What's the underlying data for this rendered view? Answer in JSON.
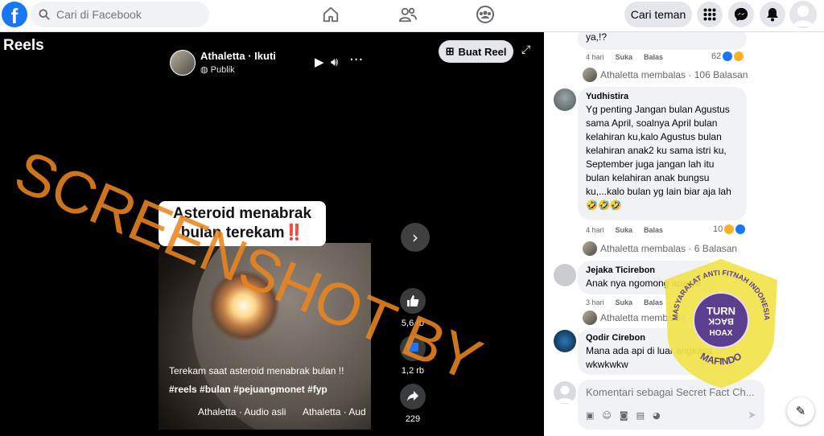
{
  "topbar": {
    "logo_letter": "f",
    "search_placeholder": "Cari di Facebook",
    "find_friends": "Cari teman"
  },
  "reels": {
    "title": "Reels",
    "author_name": "Athaletta · Ikuti",
    "privacy": "Publik",
    "create_reel": "Buat Reel",
    "caption_line1": "Asteroid menabrak",
    "caption_line2": "bulan terekam",
    "caption_mark": "‼️",
    "description": "Terekam saat asteroid menabrak bulan !!",
    "hashtags": "#reels #bulan #pejuangmonet #fyp",
    "audio_a": "Athaletta · Audio asli",
    "audio_b": "Athaletta · Aud",
    "likes": "5,6 rb",
    "comments": "1,2 rb",
    "shares": "229"
  },
  "comments": {
    "c1": {
      "text": "ya,!?",
      "time": "4 hari",
      "like": "Suka",
      "reply": "Balas",
      "reacts": "62"
    },
    "r1": "Athaletta membalas · 106 Balasan",
    "c2": {
      "author": "Yudhistira",
      "text": "Yg penting Jangan bulan Agustus sama April, soalnya April bulan kelahiran ku,kalo Agustus bulan kelahiran anak2 ku sama istri ku, September juga jangan lah itu bulan kelahiran anak bungsu ku,...kalo bulan yg lain biar aja lah🤣🤣🤣",
      "time": "4 hari",
      "like": "Suka",
      "reply": "Balas",
      "reacts": "10"
    },
    "r2": "Athaletta membalas · 6 Balasan",
    "c3": {
      "author": "Jejaka Ticirebon",
      "text": "Anak nya ngomong apa ya",
      "time": "3 hari",
      "like": "Suka",
      "reply": "Balas"
    },
    "r3": "Athaletta membalas · 2 Balasan",
    "c4": {
      "author": "Qodir Cirebon",
      "text": "Mana ada api di luar angkasa wkwkwkw"
    },
    "composer_placeholder": "Komentari sebagai Secret Fact Ch..."
  },
  "watermark": {
    "text": "SCREENSHOT BY",
    "seal_top": "MASYARAKAT ANTI FITNAH INDONESIA",
    "seal_center": "TURN BACK HOAX",
    "seal_bottom": "MAFINDO"
  },
  "colors": {
    "brand": "#1877f2",
    "watermark": "#eb841e",
    "seal_yellow": "#f2e34a",
    "seal_purple": "#5a3f8e"
  }
}
